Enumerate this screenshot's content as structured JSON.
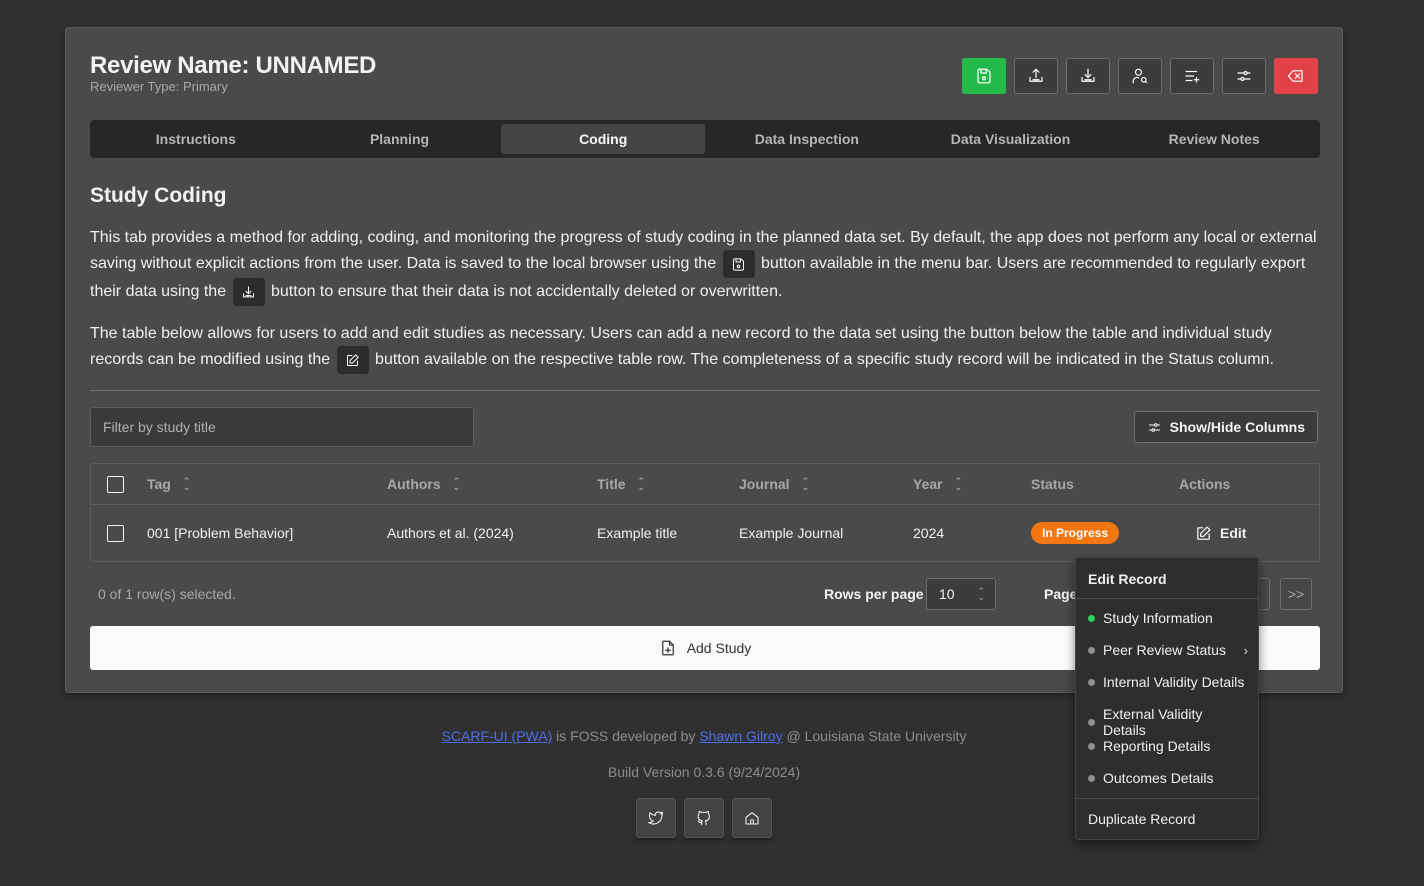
{
  "header": {
    "title": "Review Name: UNNAMED",
    "subtitle": "Reviewer Type: Primary",
    "toolbar_icons": [
      "save-icon",
      "upload-icon",
      "download-icon",
      "user-search-icon",
      "list-add-icon",
      "settings-sliders-icon",
      "clear-icon"
    ]
  },
  "tabs": [
    {
      "label": "Instructions"
    },
    {
      "label": "Planning"
    },
    {
      "label": "Coding",
      "active": true
    },
    {
      "label": "Data Inspection"
    },
    {
      "label": "Data Visualization"
    },
    {
      "label": "Review Notes"
    }
  ],
  "section": {
    "heading": "Study Coding",
    "p1_a": "This tab provides a method for adding, coding, and monitoring the progress of study coding in the planned data set. By default, the app does not perform any local or external saving without explicit actions from the user. Data is saved to the local browser using the",
    "p1_b": "button available in the menu bar. Users are recommended to regularly export their data using the",
    "p1_c": "button to ensure that their data is not accidentally deleted or overwritten.",
    "p2_a": "The table below allows for users to add and edit studies as necessary. Users can add a new record to the data set using the button below the table and individual study records can be modified using the",
    "p2_b": "button available on the respective table row. The completeness of a specific study record will be indicated in the Status column."
  },
  "filter": {
    "placeholder": "Filter by study title",
    "value": ""
  },
  "show_hide_label": "Show/Hide Columns",
  "table": {
    "columns": {
      "tag": "Tag",
      "authors": "Authors",
      "title": "Title",
      "journal": "Journal",
      "year": "Year",
      "status": "Status",
      "actions": "Actions"
    },
    "rows": [
      {
        "tag": "001 [Problem Behavior]",
        "authors": "Authors et al. (2024)",
        "title": "Example title",
        "journal": "Example Journal",
        "year": "2024",
        "status": "In Progress",
        "action": "Edit"
      }
    ]
  },
  "pagination": {
    "selected_text": "0 of 1 row(s) selected.",
    "rows_per_page_label": "Rows per page",
    "rows_per_page": "10",
    "page_label": "Page",
    "last_label": ">>"
  },
  "add_study_label": "Add Study",
  "edit_menu": {
    "title": "Edit Record",
    "items": [
      {
        "label": "Study Information",
        "status": "complete"
      },
      {
        "label": "Peer Review Status",
        "status": "incomplete",
        "submenu": true
      },
      {
        "label": "Internal Validity Details",
        "status": "incomplete"
      },
      {
        "label": "External Validity Details",
        "status": "incomplete"
      },
      {
        "label": "Reporting Details",
        "status": "incomplete"
      },
      {
        "label": "Outcomes Details",
        "status": "incomplete"
      }
    ],
    "duplicate": "Duplicate Record"
  },
  "footer": {
    "link1": "SCARF-UI (PWA)",
    "text1": " is FOSS developed by ",
    "link2": "Shawn Gilroy",
    "text2": " @ Louisiana State University",
    "build": "Build Version 0.3.6 (9/24/2024)"
  },
  "colors": {
    "save": "#23b94b",
    "clear": "#e2414a",
    "badge": "#f27612",
    "complete_dot": "#2ed15c"
  }
}
